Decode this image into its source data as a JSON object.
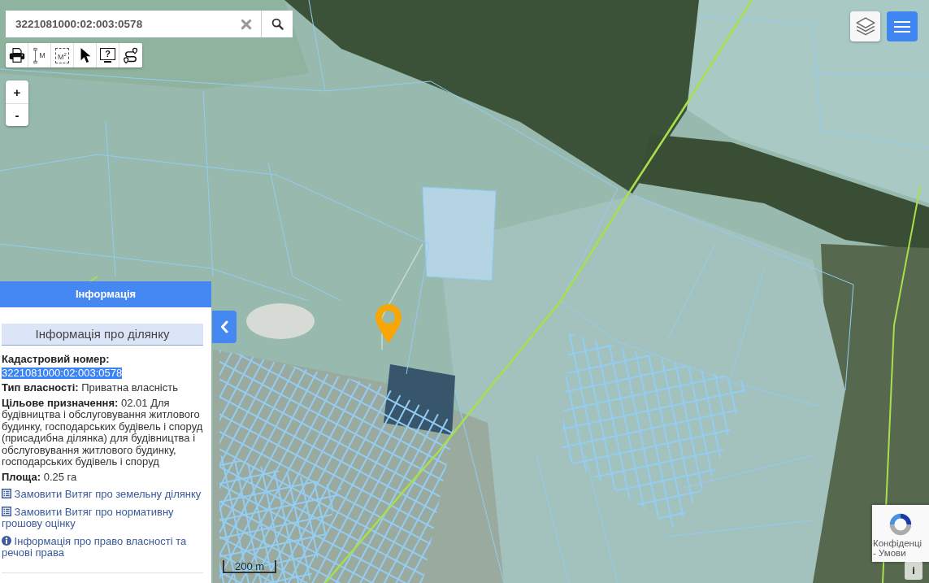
{
  "search": {
    "value": "3221081000:02:003:0578"
  },
  "toolbar": [
    {
      "kind": "print"
    },
    {
      "kind": "measure_distance",
      "label": "M"
    },
    {
      "kind": "measure_area",
      "label": "M$^{2}$"
    },
    {
      "kind": "select"
    },
    {
      "kind": "help",
      "label": "?"
    },
    {
      "kind": "route"
    }
  ],
  "zoom": {
    "zoom_in": "+",
    "zoom_out": "-"
  },
  "info_panel": {
    "title": "Інформація",
    "section_title": "Інформація про ділянку",
    "fields": [
      {
        "label": "Кадастровий номер:",
        "value": "3221081000:02:003:0578",
        "highlighted": true
      },
      {
        "label": "Тип власності:",
        "value": "Приватна власність",
        "highlighted": false
      },
      {
        "label": "Цільове призначення:",
        "value": "02.01 Для будівництва і обслуговування житлового будинку, господарських будівель і споруд (присадибна ділянка) для будівництва і обслуговування житлового будинку, господарських будівель і споруд",
        "highlighted": false
      },
      {
        "label": "Площа:",
        "value": "0.25 га",
        "highlighted": false
      }
    ],
    "links": [
      {
        "kind": "order",
        "text": "Замовити Витяг про земельну ділянку"
      },
      {
        "kind": "order",
        "text": "Замовити Витяг про нормативну грошову оцінку"
      },
      {
        "kind": "info",
        "text": "Інформація про право власності та речові права"
      }
    ]
  },
  "scale": {
    "label": "200 m"
  },
  "recaptcha": {
    "privacy": "Конфіденці",
    "terms": "- Умови"
  },
  "attribution_button": "i"
}
